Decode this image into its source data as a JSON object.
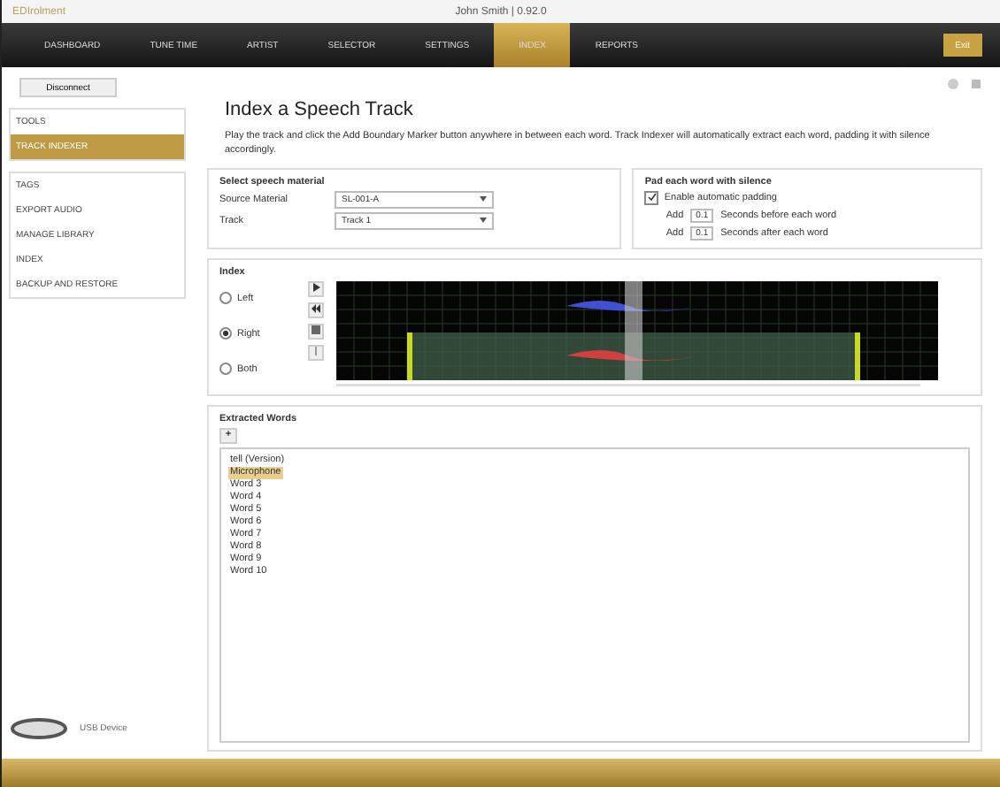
{
  "window": {
    "app_name": "EDIrolment",
    "title": "John Smith  |  0.92.0"
  },
  "nav": [
    {
      "label": "DASHBOARD",
      "selected": false
    },
    {
      "label": "TUNE TIME",
      "selected": false
    },
    {
      "label": "ARTIST",
      "selected": false
    },
    {
      "label": "SELECTOR",
      "selected": false
    },
    {
      "label": "SETTINGS",
      "selected": false
    },
    {
      "label": "INDEX",
      "selected": true
    },
    {
      "label": "REPORTS",
      "selected": false
    }
  ],
  "nav_right_button": "Exit",
  "sidebar": {
    "disconnect": "Disconnect",
    "groups": [
      [
        {
          "label": "TOOLS",
          "selected": false
        },
        {
          "label": "TRACK INDEXER",
          "selected": true
        }
      ],
      [
        {
          "label": "TAGS",
          "selected": false
        },
        {
          "label": "EXPORT AUDIO",
          "selected": false
        },
        {
          "label": "MANAGE LIBRARY",
          "selected": false
        },
        {
          "label": "INDEX",
          "selected": false
        },
        {
          "label": "BACKUP AND RESTORE",
          "selected": false
        }
      ]
    ],
    "device": "USB Device"
  },
  "main": {
    "title": "Index a Speech Track",
    "description": "Play the track and click the Add Boundary Marker button anywhere in between each word. Track Indexer will automatically extract each word, padding it with silence accordingly.",
    "select": {
      "heading": "Select speech material",
      "fields": [
        {
          "label": "Source Material",
          "value": "SL-001-A"
        },
        {
          "label": "Track",
          "value": "Track 1"
        }
      ]
    },
    "padding": {
      "heading": "Pad each word with silence",
      "checkbox": {
        "label": "Enable automatic padding",
        "checked": true
      },
      "rows": [
        {
          "prefix": "Add",
          "value": "0.1",
          "suffix": "Seconds before each word"
        },
        {
          "prefix": "Add",
          "value": "0.1",
          "suffix": "Seconds after each word"
        }
      ]
    },
    "index": {
      "heading": "Index",
      "channels": [
        {
          "label": "Left",
          "selected": false
        },
        {
          "label": "Right",
          "selected": true
        },
        {
          "label": "Both",
          "selected": false
        }
      ]
    },
    "words": {
      "heading": "Extracted Words",
      "add_button": "+",
      "items": [
        {
          "label": "tell (Version)",
          "selected": false
        },
        {
          "label": "Microphone",
          "selected": true
        },
        {
          "label": "Word 3",
          "selected": false
        },
        {
          "label": "Word 4",
          "selected": false
        },
        {
          "label": "Word 5",
          "selected": false
        },
        {
          "label": "Word 6",
          "selected": false
        },
        {
          "label": "Word 7",
          "selected": false
        },
        {
          "label": "Word 8",
          "selected": false
        },
        {
          "label": "Word 9",
          "selected": false
        },
        {
          "label": "Word 10",
          "selected": false
        }
      ]
    }
  }
}
